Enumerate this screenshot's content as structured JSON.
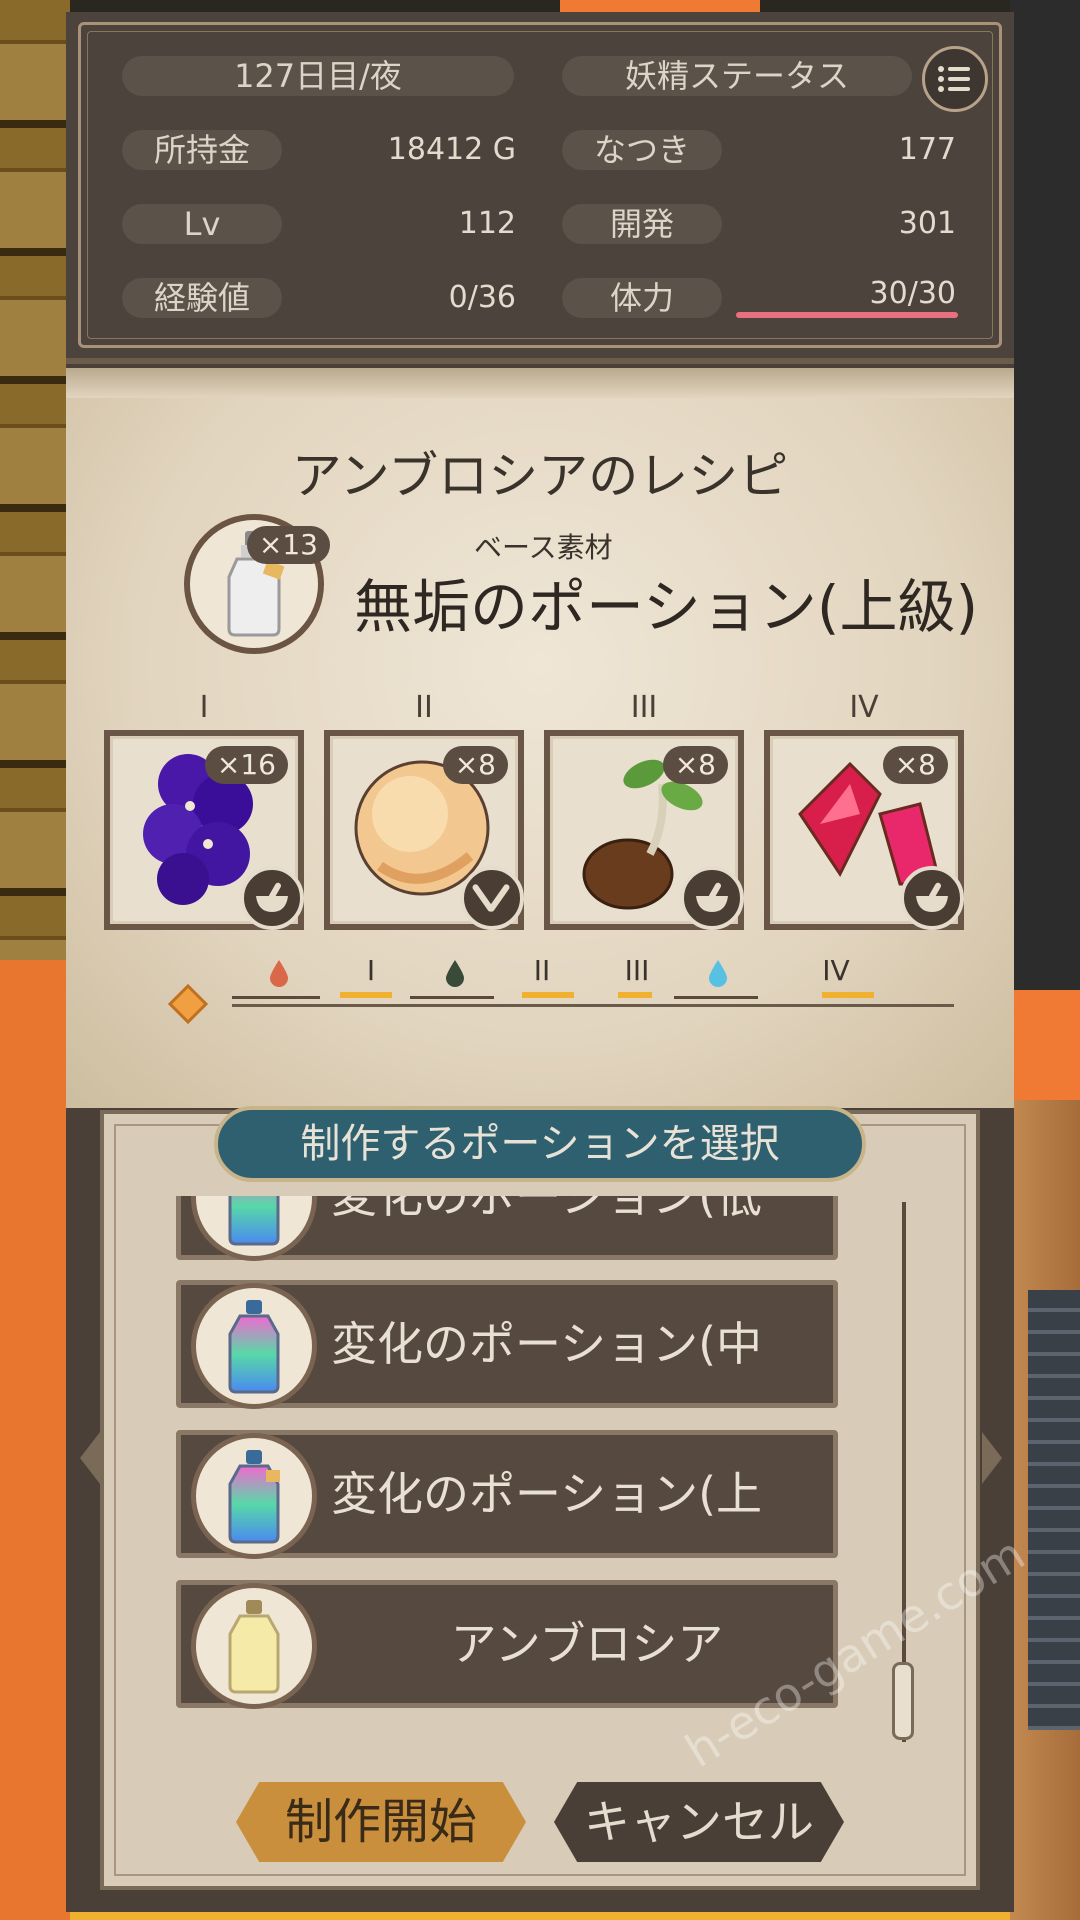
{
  "status": {
    "day": "127日目/夜",
    "fairy_status": "妖精ステータス",
    "money_label": "所持金",
    "money_value": "18412 G",
    "lv_label": "Lv",
    "lv_value": "112",
    "exp_label": "経験値",
    "exp_value": "0/36",
    "affection_label": "なつき",
    "affection_value": "177",
    "dev_label": "開発",
    "dev_value": "301",
    "hp_label": "体力",
    "hp_value": "30/30",
    "hp_fraction": 1.0
  },
  "recipe": {
    "title": "アンブロシアのレシピ",
    "base_label": "ベース素材",
    "base_name": "無垢のポーション(上級)",
    "base_count": "×13",
    "slots": [
      {
        "num": "I",
        "count": "×16",
        "item_icon": "violet-flower-icon",
        "tool_icon": "mortar-icon"
      },
      {
        "num": "II",
        "count": "×8",
        "item_icon": "peach-icon",
        "tool_icon": "knife-fork-icon"
      },
      {
        "num": "III",
        "count": "×8",
        "item_icon": "sprout-seed-icon",
        "tool_icon": "mortar-icon"
      },
      {
        "num": "IV",
        "count": "×8",
        "item_icon": "red-crystal-icon",
        "tool_icon": "mortar-icon"
      }
    ],
    "track_labels": [
      "I",
      "II",
      "III",
      "IV"
    ]
  },
  "dialog": {
    "title": "制作するポーションを選択",
    "items": [
      {
        "label": "変化のポーション(低級)",
        "icon": "rainbow-potion-icon"
      },
      {
        "label": "変化のポーション(中級)",
        "icon": "rainbow-potion-icon"
      },
      {
        "label": "変化のポーション(上級)",
        "icon": "rainbow-potion-icon"
      },
      {
        "label": "アンブロシア",
        "icon": "golden-potion-icon"
      }
    ],
    "start_label": "制作開始",
    "cancel_label": "キャンセル"
  },
  "watermark": "h-eco-game.com",
  "colors": {
    "panel_dark": "#4b433c",
    "parchment": "#e2d5bf",
    "banner_teal": "#2e6070",
    "accent_gold": "#f0b030",
    "hp_red": "#e87080"
  }
}
